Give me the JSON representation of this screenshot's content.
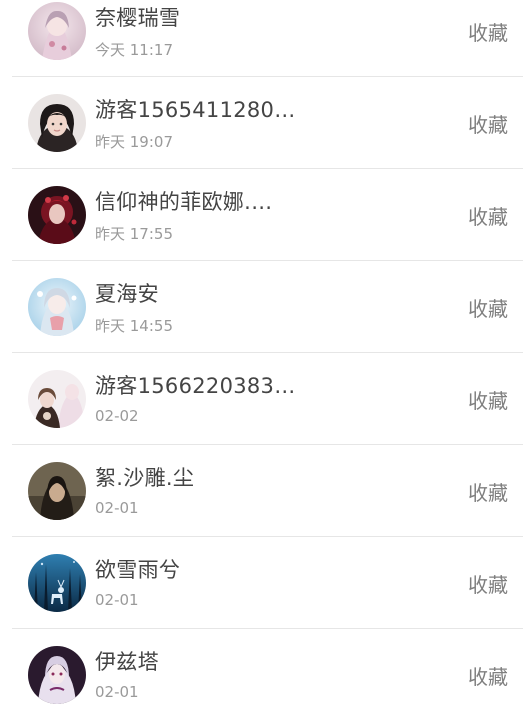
{
  "users": [
    {
      "name": "奈樱瑞雪",
      "time": "今天 11:17",
      "action": "收藏",
      "avatar": "anime-girl-pink-avatar-icon"
    },
    {
      "name": "游客1565411280…",
      "time": "昨天 19:07",
      "action": "收藏",
      "avatar": "girl-photo-avatar-icon"
    },
    {
      "name": "信仰神的菲欧娜.…",
      "time": "昨天 17:55",
      "action": "收藏",
      "avatar": "red-dark-anime-avatar-icon"
    },
    {
      "name": "夏海安",
      "time": "昨天 14:55",
      "action": "收藏",
      "avatar": "blue-anime-girl-avatar-icon"
    },
    {
      "name": "游客1566220383…",
      "time": "02-02",
      "action": "收藏",
      "avatar": "doll-avatar-icon"
    },
    {
      "name": "絮.沙雕.尘",
      "time": "02-01",
      "action": "收藏",
      "avatar": "dark-hair-girl-avatar-icon"
    },
    {
      "name": "欲雪雨兮",
      "time": "02-01",
      "action": "收藏",
      "avatar": "blue-forest-deer-avatar-icon"
    },
    {
      "name": "伊兹塔",
      "time": "02-01",
      "action": "收藏",
      "avatar": "purple-anime-avatar-icon"
    }
  ]
}
